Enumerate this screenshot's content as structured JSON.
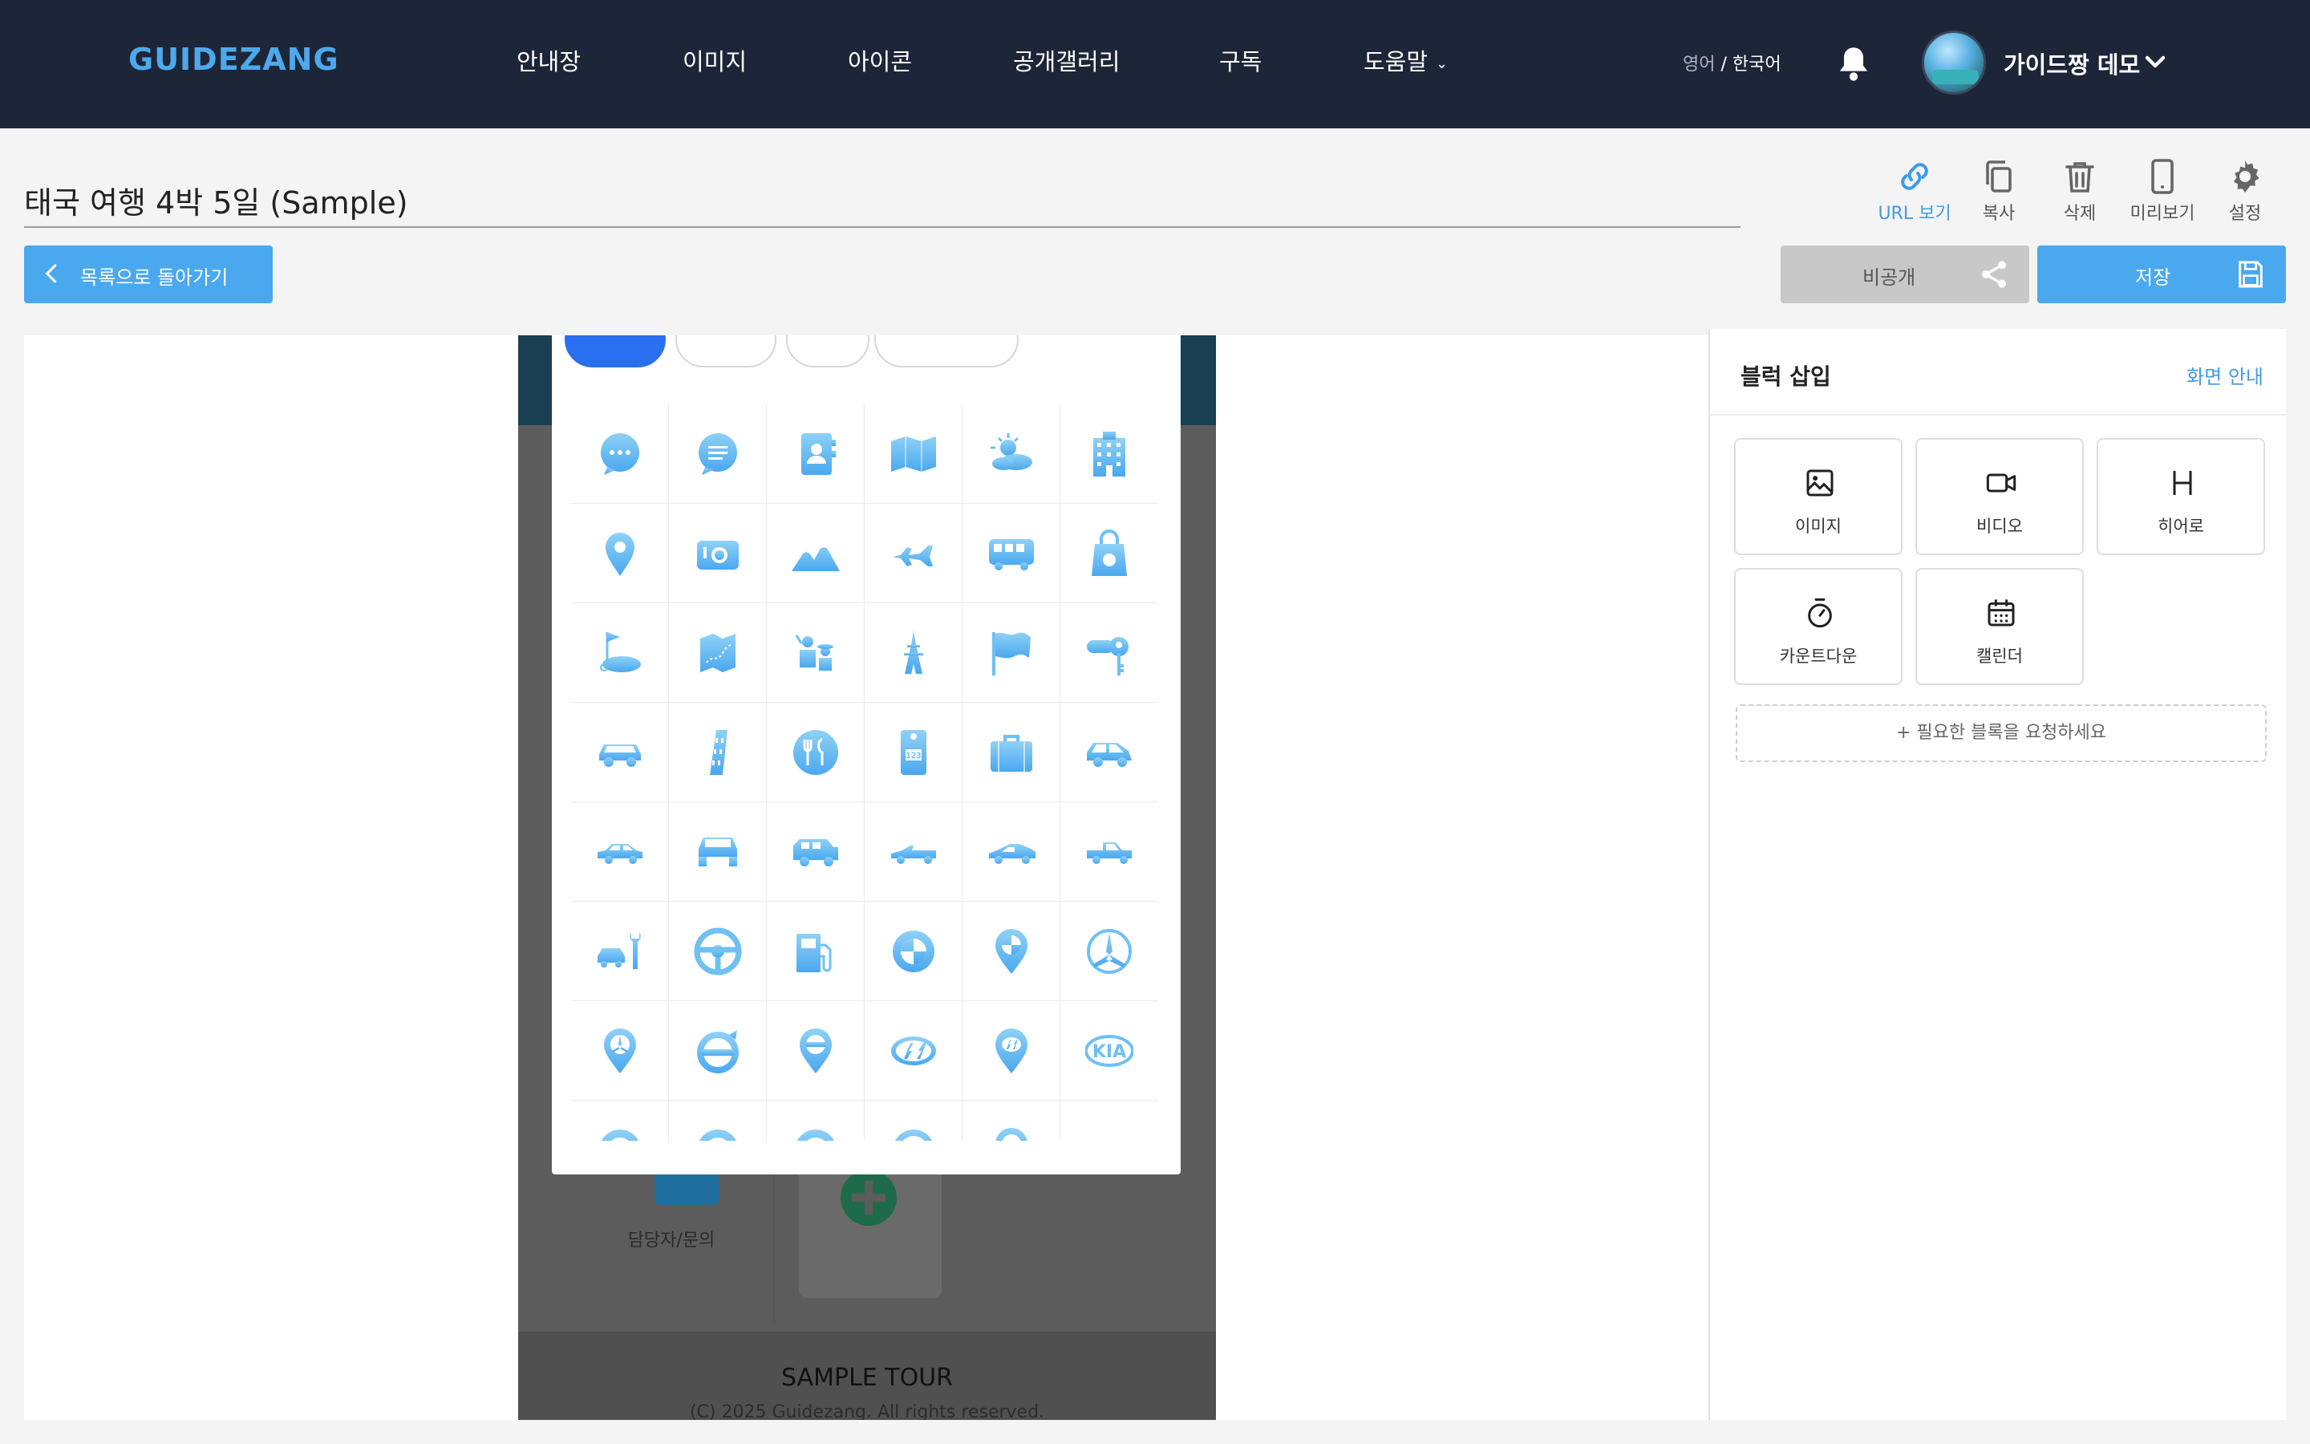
{
  "brand": {
    "logo": "GUIDEZANG",
    "accent": "#4aa8ef",
    "nav_bg": "#1d2638"
  },
  "nav": {
    "items": [
      "안내장",
      "이미지",
      "아이콘",
      "공개갤러리",
      "구독",
      "도움말"
    ],
    "lang_en": "영어",
    "lang_sep": " / ",
    "lang_ko": "한국어",
    "user_name": "가이드짱 데모"
  },
  "page": {
    "title": "태국 여행 4박 5일 (Sample)"
  },
  "toolbar": [
    {
      "label": "URL 보기",
      "icon": "link-icon"
    },
    {
      "label": "복사",
      "icon": "copy-icon"
    },
    {
      "label": "삭제",
      "icon": "trash-icon"
    },
    {
      "label": "미리보기",
      "icon": "mobile-icon"
    },
    {
      "label": "설정",
      "icon": "gear-icon"
    }
  ],
  "actions": {
    "back": "목록으로 돌아가기",
    "private": "비공개",
    "save": "저장"
  },
  "preview": {
    "contact_label": "담당자/문의",
    "footer_title": "SAMPLE TOUR",
    "footer_copy": "(C) 2025 Guidezang. All rights reserved."
  },
  "icon_grid": [
    "speech-bubble-dots-icon",
    "speech-bubble-lines-icon",
    "address-book-icon",
    "folded-map-icon",
    "weather-sun-cloud-icon",
    "building-icon",
    "map-pin-icon",
    "camera-icon",
    "mountains-icon",
    "airplane-icon",
    "bus-icon",
    "shopping-bag-icon",
    "golf-flag-icon",
    "map-route-icon",
    "tour-guide-icon",
    "eiffel-tower-icon",
    "waving-flag-icon",
    "car-key-icon",
    "car-front-icon",
    "leaning-tower-icon",
    "restaurant-icon",
    "hotel-room-tag-icon",
    "suitcase-icon",
    "suv-icon",
    "car-sedan-icon",
    "car-front-view-icon",
    "jeep-icon",
    "convertible-icon",
    "sports-car-icon",
    "pickup-icon",
    "car-repair-icon",
    "steering-wheel-icon",
    "fuel-pump-icon",
    "bmw-logo-icon",
    "bmw-pin-icon",
    "mercedes-logo-icon",
    "mercedes-pin-icon",
    "volvo-logo-icon",
    "volvo-pin-icon",
    "hyundai-logo-icon",
    "hyundai-pin-icon",
    "kia-logo-icon",
    "brand-badge-icon",
    "brand-badge-icon",
    "brand-badge-icon",
    "vw-logo-icon",
    "vw-pin-icon",
    "brand-wing-icon"
  ],
  "panel": {
    "title": "블럭 삽입",
    "help": "화면 안내",
    "blocks": [
      {
        "label": "이미지",
        "icon": "image-icon"
      },
      {
        "label": "비디오",
        "icon": "video-icon"
      },
      {
        "label": "히어로",
        "icon": "heading-icon"
      },
      {
        "label": "카운트다운",
        "icon": "stopwatch-icon"
      },
      {
        "label": "캘린더",
        "icon": "calendar-icon"
      }
    ],
    "request": "+ 필요한 블록을 요청하세요"
  }
}
